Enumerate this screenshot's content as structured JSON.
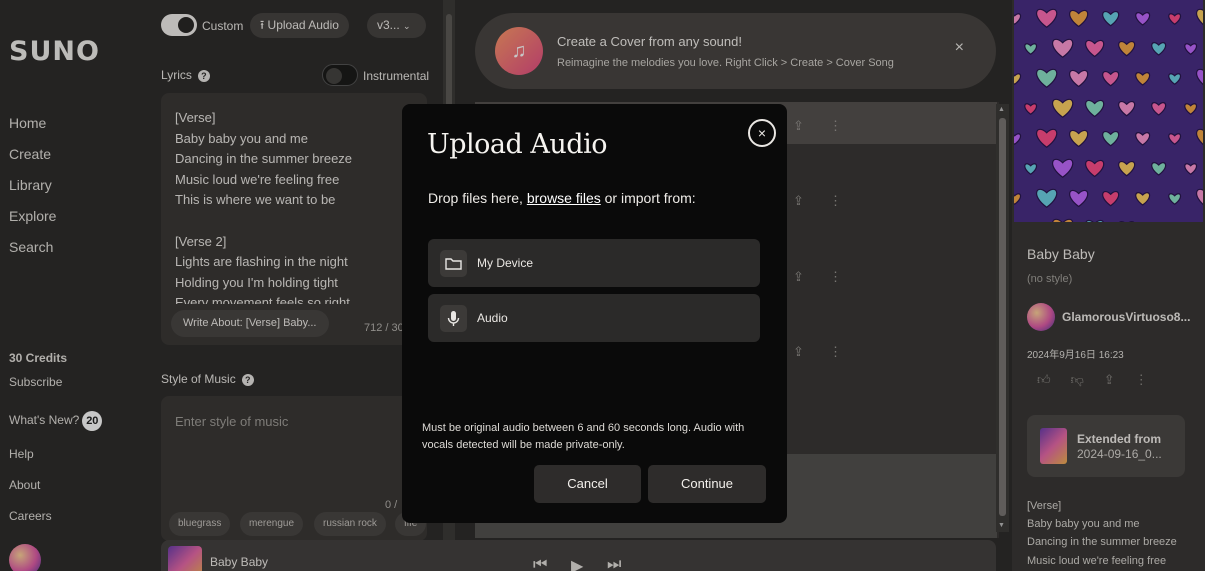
{
  "app": {
    "logo": "SUNO"
  },
  "sidebar": {
    "nav": [
      "Home",
      "Create",
      "Library",
      "Explore",
      "Search"
    ],
    "credits": "30 Credits",
    "subscribe": "Subscribe",
    "whats_new": "What's New?",
    "whats_new_count": "20",
    "links": [
      "Help",
      "About",
      "Careers"
    ]
  },
  "create": {
    "custom_label": "Custom",
    "upload_label": "Upload Audio",
    "version_label": "v3...",
    "lyrics_label": "Lyrics",
    "instrumental_label": "Instrumental",
    "lyrics_text": "[Verse]\nBaby baby you and me\nDancing in the summer breeze\nMusic loud we're feeling free\nThis is where we want to be\n\n[Verse 2]\nLights are flashing in the night\nHolding you I'm holding tight\nEvery movement feels so right",
    "write_about": "Write About: [Verse] Baby...",
    "lyrics_counter": "712 / 30",
    "style_label": "Style of Music",
    "style_placeholder": "Enter style of music",
    "style_counter": "0 /",
    "tags": [
      "bluegrass",
      "merengue",
      "russian rock",
      "fife"
    ]
  },
  "banner": {
    "title": "Create a Cover from any sound!",
    "subtitle": "Reimagine the melodies you love. Right Click > Create > Cover Song",
    "close": "×"
  },
  "detail": {
    "title": "Baby Baby",
    "style": "(no style)",
    "user": "GlamorousVirtuoso8...",
    "date": "2024年9月16日 16:23",
    "extended_label": "Extended from",
    "extended_date": "2024-09-16_0...",
    "lyrics": "[Verse]\nBaby baby you and me\nDancing in the summer breeze\nMusic loud we're feeling free"
  },
  "player": {
    "title": "Baby Baby"
  },
  "modal": {
    "title": "Upload Audio",
    "drop_prefix": "Drop files here, ",
    "browse": "browse files",
    "drop_suffix": " or import from:",
    "options": [
      "My Device",
      "Audio"
    ],
    "note": "Must be original audio between 6 and 60 seconds long. Audio with vocals detected will be made private-only.",
    "cancel": "Cancel",
    "continue": "Continue",
    "close": "×"
  }
}
